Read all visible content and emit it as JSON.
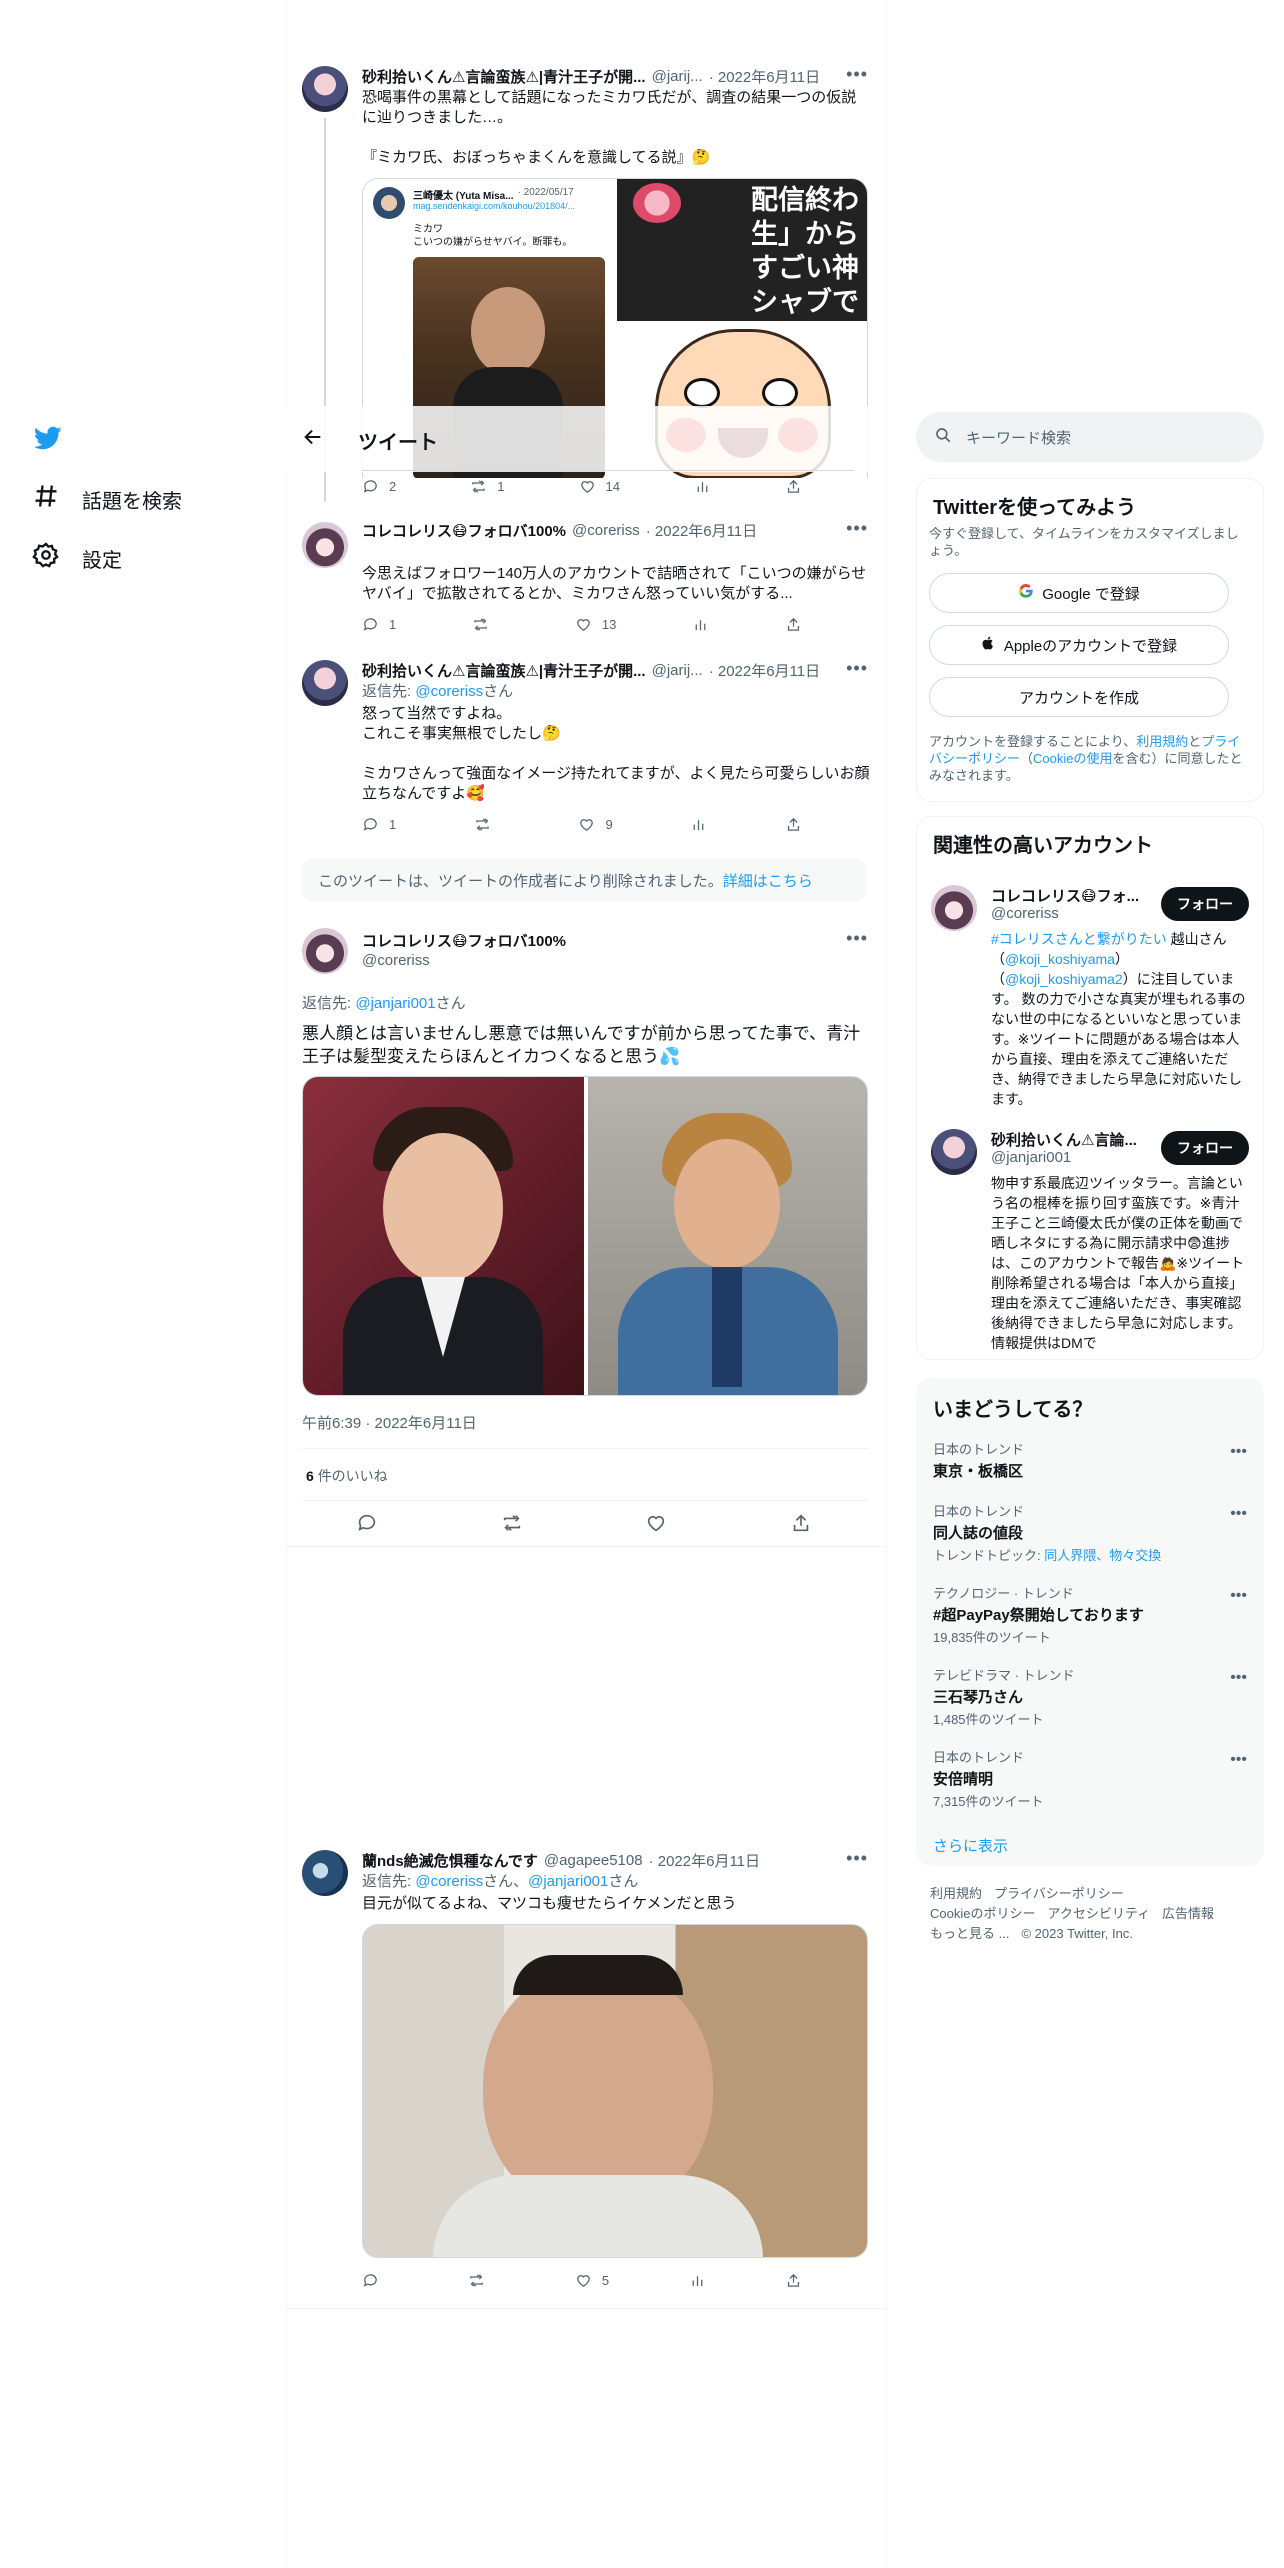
{
  "nav": {
    "explore_label": "話題を検索",
    "settings_label": "設定"
  },
  "header": {
    "title": "ツイート"
  },
  "search": {
    "placeholder": "キーワード検索"
  },
  "tweets": {
    "t1": {
      "name": "砂利拾いくん⚠言論蛮族⚠|青汁王子が開...",
      "handle": "@jarij...",
      "date": "· 2022年6月11日",
      "text": "恐喝事件の黒幕として話題になったミカワ氏だが、調査の結果一つの仮説に辿りつきました…。\n\n『ミカワ氏、おぼっちゃまくんを意識してる説』🤔",
      "embed_name": "三崎優太 (Yuta Misa...",
      "embed_date": "· 2022/05/17",
      "embed_link": "mag.sendenkaigi.com/kouhou/201804/...",
      "embed_text": "ミカワ\nこいつの嫌がらせヤバイ。断罪も。",
      "overlay_text": "配信終わ\n生」から\nすごい神\nシャブで",
      "reply_count": "2",
      "retweet_count": "1",
      "like_count": "14"
    },
    "t2": {
      "name": "コレコレリス😷フォロバ100%",
      "handle": "@coreriss",
      "date": "· 2022年6月11日",
      "text": "今思えばフォロワー140万人のアカウントで詰晒されて「こいつの嫌がらせヤバイ」で拡散されてるとか、ミカワさん怒っていい気がする...",
      "reply_count": "1",
      "retweet_count": "",
      "like_count": "13"
    },
    "t3": {
      "name": "砂利拾いくん⚠言論蛮族⚠|青汁王子が開...",
      "handle": "@jarij...",
      "date": "· 2022年6月11日",
      "reply_prefix": "返信先: ",
      "reply_user": "@coreriss",
      "reply_suffix": "さん",
      "text": "怒って当然ですよね。\nこれこそ事実無根でしたし🤔\n\nミカワさんって強面なイメージ持たれてますが、よく見たら可愛らしいお顔立ちなんですよ🥰",
      "reply_count": "1",
      "retweet_count": "",
      "like_count": "9"
    },
    "deleted": {
      "text": "このツイートは、ツイートの作成者により削除されました。",
      "link": "詳細はこちら"
    },
    "main": {
      "name": "コレコレリス😷フォロバ100%",
      "handle": "@coreriss",
      "reply_prefix": "返信先: ",
      "reply_user": "@janjari001",
      "reply_suffix": "さん",
      "text": "悪人顔とは言いませんし悪意では無いんですが前から思ってた事で、青汁王子は髪型変えたらほんとイカつくなると思う💦",
      "timestamp": "午前6:39 · 2022年6月11日",
      "likes_count": "6",
      "likes_label": "件のいいね"
    },
    "t4": {
      "name": "蘭nds絶滅危惧種なんです",
      "handle": "@agapee5108",
      "date": "· 2022年6月11日",
      "reply_prefix": "返信先: ",
      "reply_user1": "@coreriss",
      "reply_mid": "さん、",
      "reply_user2": "@janjari001",
      "reply_suffix": "さん",
      "text": "目元が似てるよね、マツコも痩せたらイケメンだと思う",
      "reply_count": "",
      "retweet_count": "",
      "like_count": "5"
    }
  },
  "signup": {
    "title": "Twitterを使ってみよう",
    "subtitle": "今すぐ登録して、タイムラインをカスタマイズしましょう。",
    "google_label": "Google で登録",
    "apple_label": "Appleのアカウントで登録",
    "create_label": "アカウントを作成",
    "legal_prefix": "アカウントを登録することにより、",
    "legal_link1": "利用規約",
    "legal_and": "と",
    "legal_link2": "プライバシーポリシー",
    "legal_paren_open": "（",
    "legal_link3": "Cookieの使用",
    "legal_suffix": "を含む）に同意したとみなされます。"
  },
  "related": {
    "title": "関連性の高いアカウント",
    "follow_label": "フォロー",
    "accounts": [
      {
        "name": "コレコレリス😷フォ...",
        "handle": "@coreriss",
        "bio_link1": "#コレリスさんと繋がりたい",
        "bio_1": " 越山さん（",
        "bio_link2": "@koji_koshiyama",
        "bio_2": "）（",
        "bio_link3": "@koji_koshiyama2",
        "bio_3": "）に注目しています。 数の力で小さな真実が埋もれる事のない世の中になるといいなと思っています。※ツイートに問題がある場合は本人から直接、理由を添えてご連絡いただき、納得できましたら早急に対応いたします。"
      },
      {
        "name": "砂利拾いくん⚠言論...",
        "handle": "@janjari001",
        "bio": "物申す系最底辺ツイッタラー。言論という名の棍棒を振り回す蛮族です。※青汁王子こと三崎優太氏が僕の正体を動画で晒しネタにする為に開示請求中😨進捗は、このアカウントで報告🙇※ツイート削除希望される場合は「本人から直接」理由を添えてご連絡いただき、事実確認後納得できましたら早急に対応します。情報提供はDMで"
      }
    ]
  },
  "trends": {
    "title": "いまどうしてる？",
    "items": [
      {
        "category": "日本のトレンド",
        "title": "東京・板橋区",
        "extra": ""
      },
      {
        "category": "日本のトレンド",
        "title": "同人誌の値段",
        "extra_prefix": "トレンドトピック: ",
        "extra_links": "同人界隈、物々交換"
      },
      {
        "category": "テクノロジー · トレンド",
        "title": "#超PayPay祭開始しております",
        "extra": "19,835件のツイート"
      },
      {
        "category": "テレビドラマ · トレンド",
        "title": "三石琴乃さん",
        "extra": "1,485件のツイート"
      },
      {
        "category": "日本のトレンド",
        "title": "安倍晴明",
        "extra": "7,315件のツイート"
      }
    ],
    "show_more": "さらに表示"
  },
  "footer": {
    "terms": "利用規約",
    "privacy": "プライバシーポリシー",
    "cookie": "Cookieのポリシー",
    "accessibility": "アクセシビリティ",
    "ads": "広告情報",
    "more": "もっと見る ...",
    "copyright": "© 2023 Twitter, Inc."
  },
  "colors": {
    "accent": "#1d9bf0",
    "text": "#0f1419",
    "muted": "#536471"
  }
}
